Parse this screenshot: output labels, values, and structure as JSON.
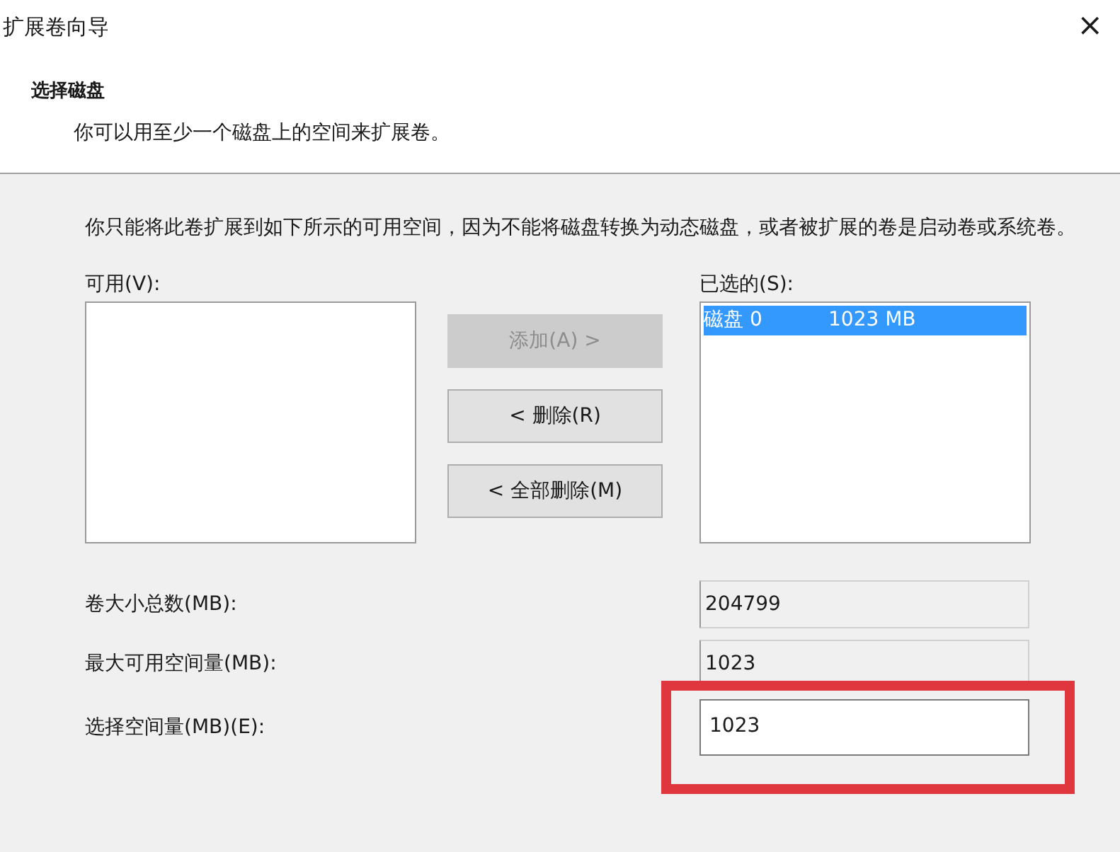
{
  "window": {
    "title": "扩展卷向导",
    "close": "×"
  },
  "header": {
    "title": "选择磁盘",
    "subtitle": "你可以用至少一个磁盘上的空间来扩展卷。"
  },
  "description": "你只能将此卷扩展到如下所示的可用空间，因为不能将磁盘转换为动态磁盘，或者被扩展的卷是启动卷或系统卷。",
  "available": {
    "label": "可用(V):"
  },
  "buttons": [
    {
      "label": "添加(A) >",
      "disabled": true
    },
    {
      "label": "< 删除(R)",
      "disabled": false
    },
    {
      "label": "< 全部删除(M)",
      "disabled": false
    }
  ],
  "selected_list": {
    "label": "已选的(S):",
    "items": [
      {
        "name": "磁盘 0",
        "size": "1023 MB",
        "selected": true
      }
    ]
  },
  "fields": [
    {
      "label": "卷大小总数(MB):",
      "value": "204799",
      "kind": "readonly"
    },
    {
      "label": "最大可用空间量(MB):",
      "value": "1023",
      "kind": "readonly"
    },
    {
      "label": "选择空间量(MB)(E):",
      "value": "1023",
      "kind": "spin",
      "highlighted": true
    }
  ]
}
